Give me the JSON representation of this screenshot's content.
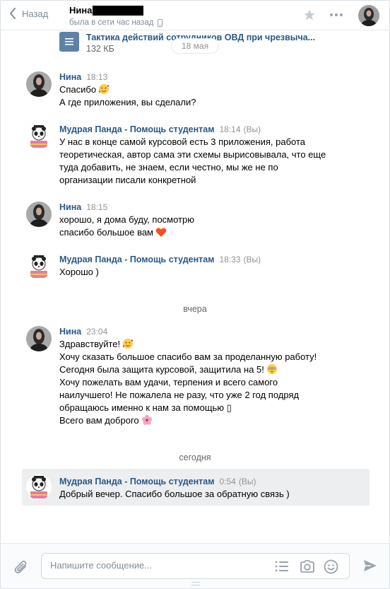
{
  "header": {
    "back_label": "Назад",
    "peer_name": "Нина",
    "peer_status": "была в сети час назад"
  },
  "attachment": {
    "file_name": "Тактика действий сотрудников ОВД при чрезвыча...",
    "file_size": "132 КБ"
  },
  "date_pill": "18 мая",
  "messages": [
    {
      "author": "Нина",
      "time": "18:13",
      "lines": [
        "Спасибо",
        "А где приложения, вы сделали?"
      ]
    },
    {
      "author": "Мудрая Панда - Помощь студентам",
      "time": "18:14",
      "you": "(Вы)",
      "lines": [
        "У нас в конце самой курсовой есть 3 приложения, работа",
        "теоретическая, автор сама эти схемы вырисовывала, что еще",
        "туда добавить, не знаем, если честно, мы же не по",
        "организации писали конкретной"
      ]
    },
    {
      "author": "Нина",
      "time": "18:15",
      "lines": [
        "хорошо, я дома буду, посмотрю",
        "спасибо большое вам"
      ]
    },
    {
      "author": "Мудрая Панда - Помощь студентам",
      "time": "18:33",
      "you": "(Вы)",
      "lines": [
        "Хорошо )"
      ]
    },
    {
      "author": "Нина",
      "time": "23:04",
      "lines": [
        "Здравствуйте!",
        "Хочу сказать большое спасибо вам за проделанную работу!",
        "Сегодня была защита курсовой, защитила на 5!",
        "Хочу пожелать вам удачи, терпения и всего самого",
        "наилучшего! Не пожалела не разу, что уже 2 год подряд",
        "обращаюсь именно к нам за помощью ▯",
        "Всего вам доброго"
      ]
    },
    {
      "author": "Мудрая Панда - Помощь студентам",
      "time": "0:54",
      "you": "(Вы)",
      "lines": [
        "Добрый вечер. Спасибо большое за обратную связь )"
      ]
    }
  ],
  "separators": {
    "yesterday": "вчера",
    "today": "сегодня"
  },
  "composer": {
    "placeholder": "Напишите сообщение..."
  },
  "colors": {
    "link": "#2a5885",
    "muted": "#939393",
    "icon": "#99a2ad",
    "highlight": "#edeef0"
  }
}
